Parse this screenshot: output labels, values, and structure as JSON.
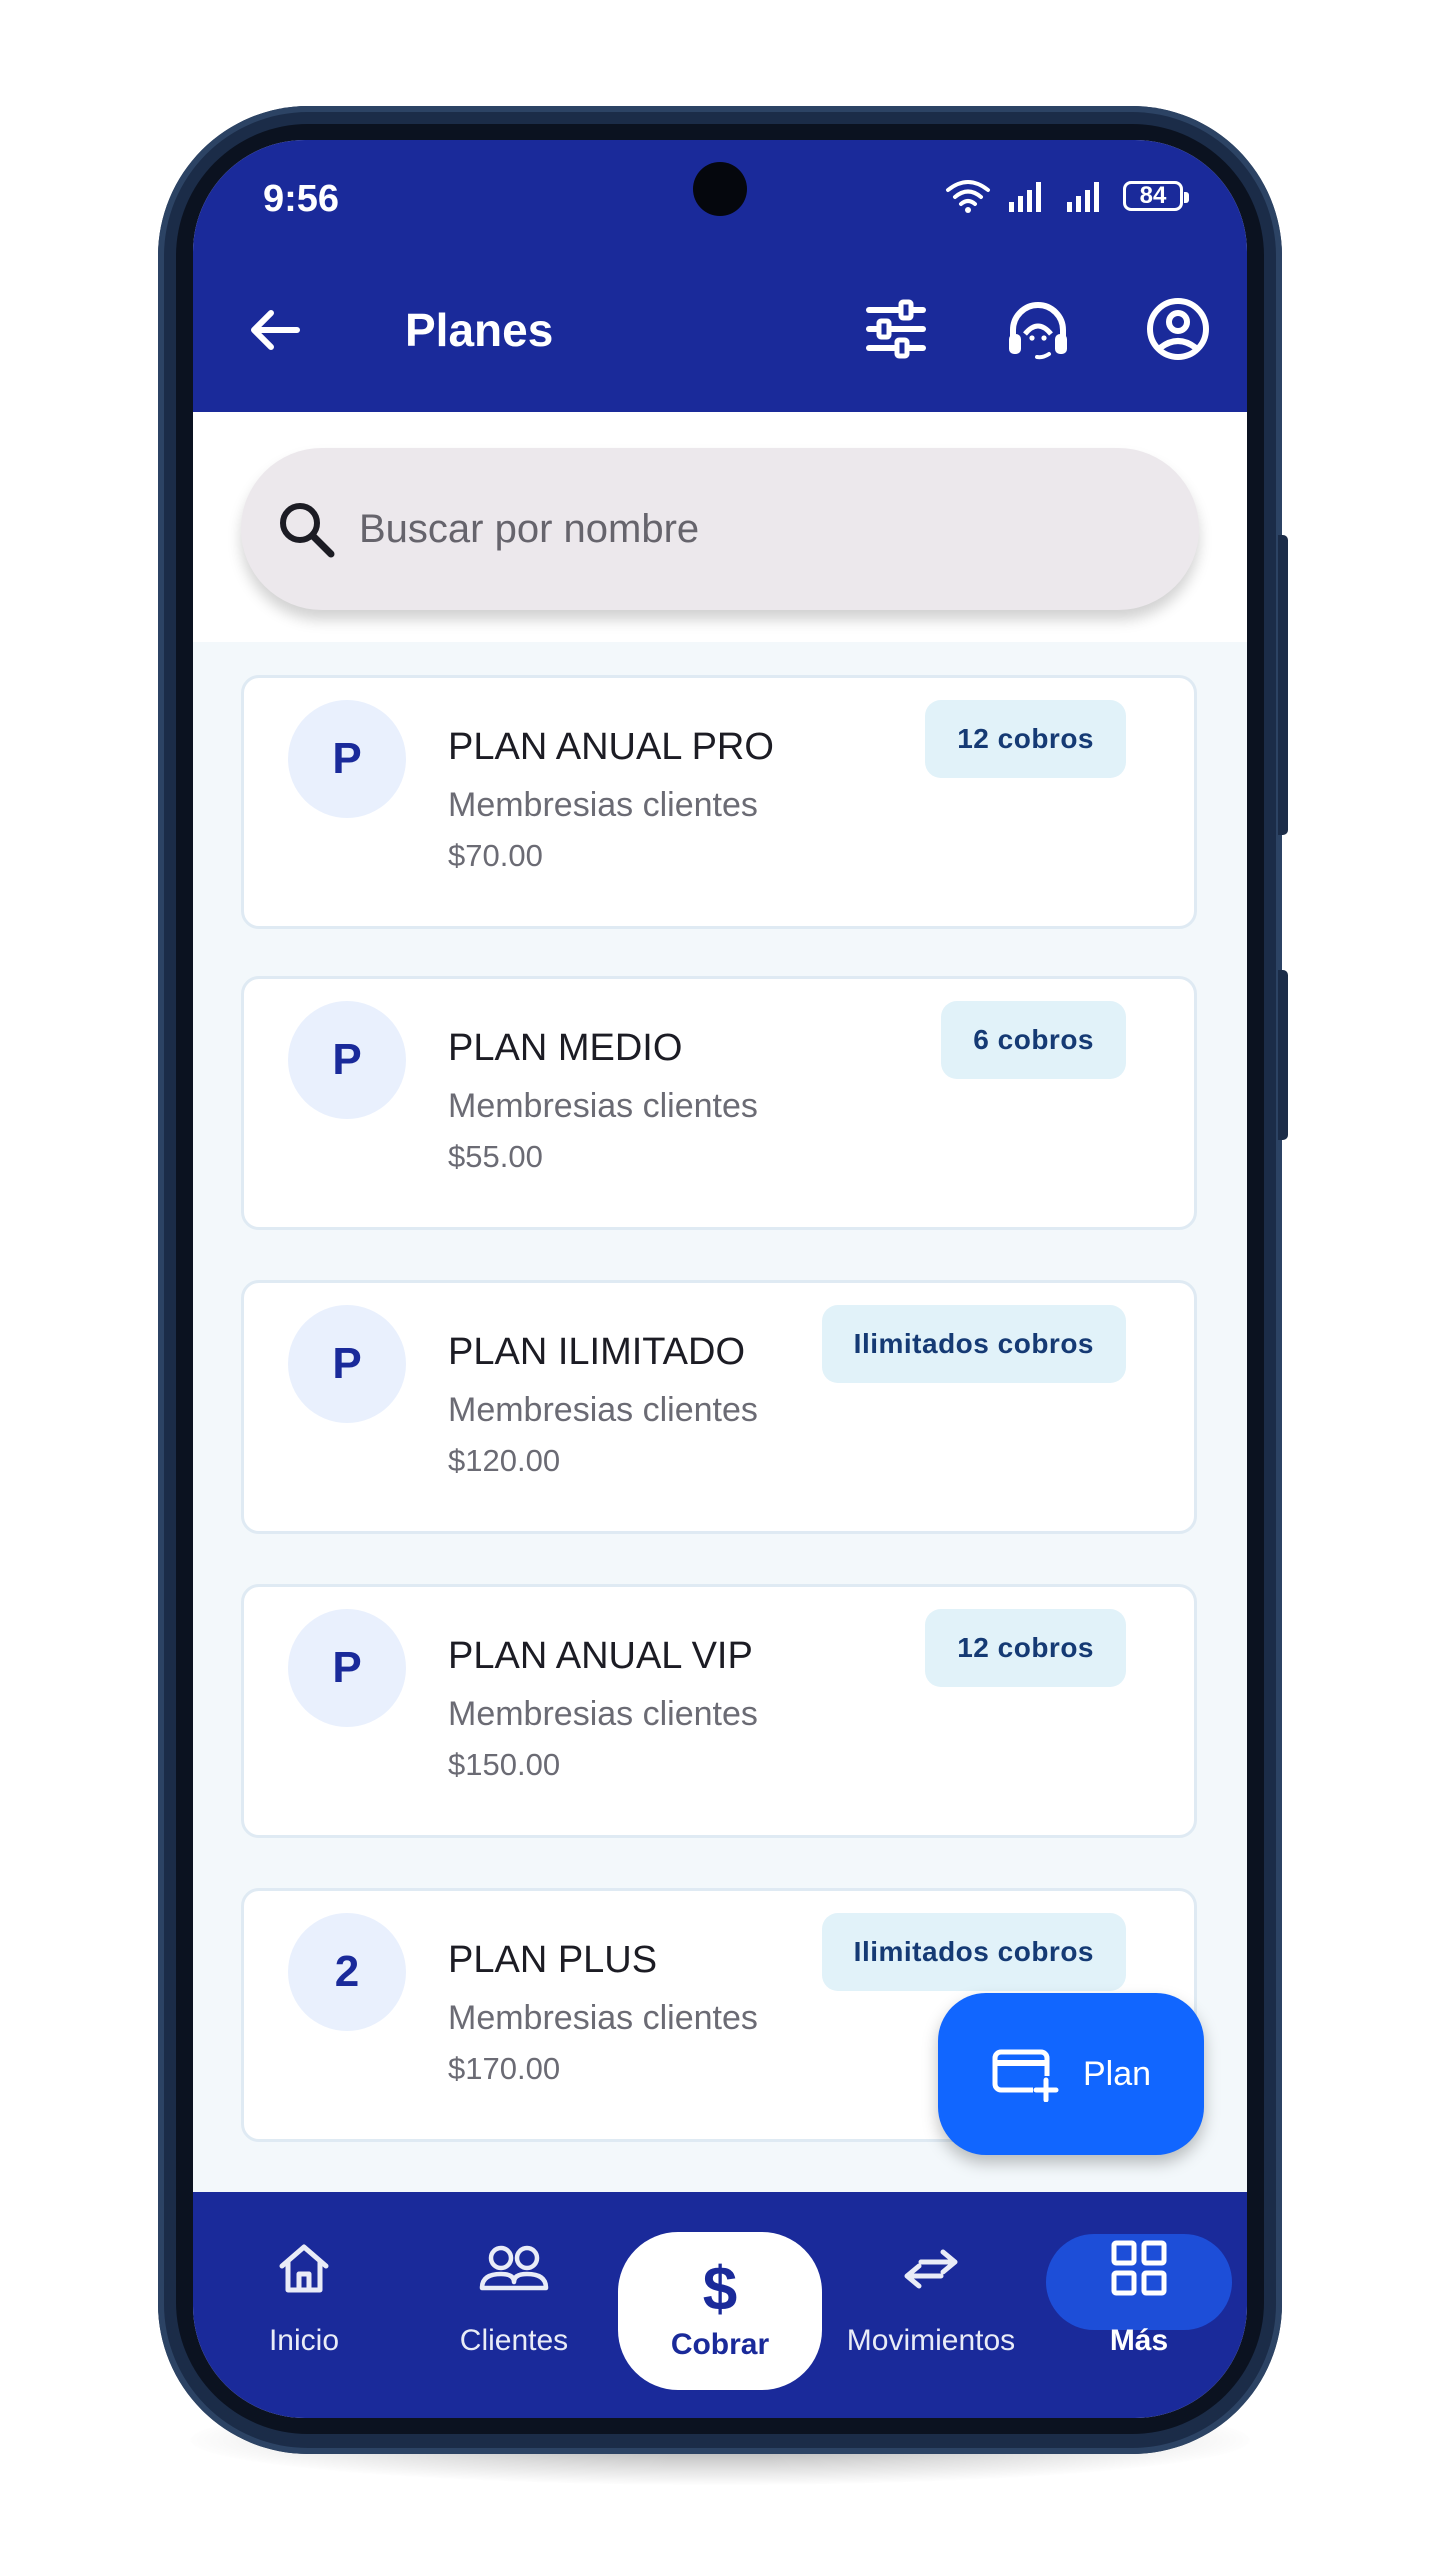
{
  "status_bar": {
    "time": "9:56",
    "battery": "84"
  },
  "app_bar": {
    "title": "Planes"
  },
  "search": {
    "placeholder": "Buscar por nombre"
  },
  "plans": [
    {
      "avatar": "P",
      "name": "PLAN ANUAL PRO",
      "category": "Membresias clientes",
      "price": "$70.00",
      "badge": "12 cobros"
    },
    {
      "avatar": "P",
      "name": "PLAN MEDIO",
      "category": "Membresias clientes",
      "price": "$55.00",
      "badge": "6 cobros"
    },
    {
      "avatar": "P",
      "name": "PLAN ILIMITADO",
      "category": "Membresias clientes",
      "price": "$120.00",
      "badge": "Ilimitados cobros"
    },
    {
      "avatar": "P",
      "name": "PLAN ANUAL VIP",
      "category": "Membresias clientes",
      "price": "$150.00",
      "badge": "12 cobros"
    },
    {
      "avatar": "2",
      "name": "PLAN PLUS",
      "category": "Membresias clientes",
      "price": "$170.00",
      "badge": "Ilimitados cobros"
    }
  ],
  "fab": {
    "label": "Plan"
  },
  "bottom_nav": {
    "items": [
      {
        "label": "Inicio"
      },
      {
        "label": "Clientes"
      },
      {
        "label": "Cobrar",
        "symbol": "$"
      },
      {
        "label": "Movimientos"
      },
      {
        "label": "Más"
      }
    ]
  },
  "colors": {
    "primary": "#1a2a9a",
    "fab": "#1166ff",
    "badge_bg": "#e1f2f9",
    "active_nav": "#1d4ed8"
  }
}
